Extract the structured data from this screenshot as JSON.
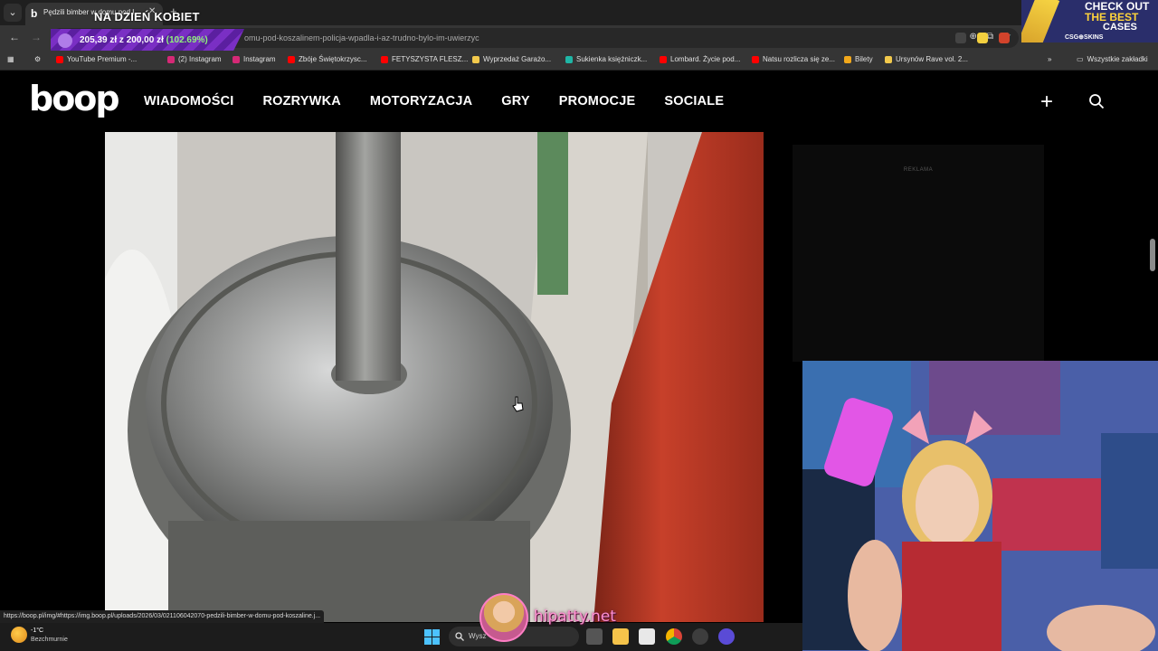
{
  "browser": {
    "tab_title": "Pędzili bimber w domu pod Koszalinem",
    "overlay_title": "NA DZIEŃ KOBIET",
    "url": "omu-pod-koszalinem-policja-wpadla-i-az-trudno-bylo-im-uwierzyc",
    "donation": {
      "amount": "205,39 zł z 200,00 zł",
      "percent": "(102.69%)"
    },
    "bookmarks": [
      {
        "label": "YouTube Premium -...",
        "color": "#ff0000"
      },
      {
        "label": "(2) Instagram",
        "color": "#d62976"
      },
      {
        "label": "Instagram",
        "color": "#d62976"
      },
      {
        "label": "Zbóje Świętokrzysc...",
        "color": "#ff0000"
      },
      {
        "label": "FETYSZYSTA FLESZ...",
        "color": "#ff0000"
      },
      {
        "label": "Wyprzedaż Garażo...",
        "color": "#f2c94c"
      },
      {
        "label": "Sukienka księżniczk...",
        "color": "#1fb6a6"
      },
      {
        "label": "Lombard. Życie pod...",
        "color": "#ff0000"
      },
      {
        "label": "Natsu rozlicza się ze...",
        "color": "#ff0000"
      },
      {
        "label": "Bilety",
        "color": "#f2a81b"
      },
      {
        "label": "Ursynów Rave vol. 2...",
        "color": "#f2c94c"
      }
    ],
    "bookmarks_all": "Wszystkie zakładki",
    "status_url": "https://boop.pl/img/#https://img.boop.pl/uploads/2026/03/021106042070-pedzili-bimber-w-domu-pod-koszaline.j..."
  },
  "ad_top": {
    "line1": "CHECK OUT",
    "line2": "THE BEST",
    "line3": "CASES",
    "brand": "CSG⊕SKINS"
  },
  "site": {
    "logo": "boop",
    "nav": [
      "WIADOMOŚCI",
      "ROZRYWKA",
      "MOTORYZACJA",
      "GRY",
      "PROMOCJE",
      "SOCIALE"
    ],
    "ad_label": "REKLAMA"
  },
  "taskbar": {
    "temp": "-1°C",
    "weather": "Bezchmurnie",
    "search_placeholder": "Wysz"
  },
  "stream_overlay": {
    "handle": "hipatty.net"
  }
}
